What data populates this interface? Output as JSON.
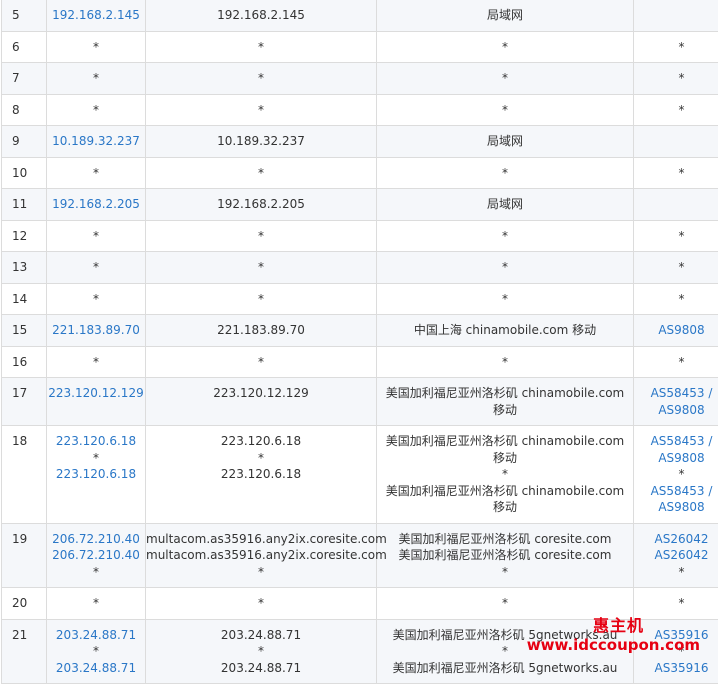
{
  "rows": [
    {
      "hop": "5",
      "ips": [
        "192.168.2.145"
      ],
      "hosts": [
        "192.168.2.145"
      ],
      "locs": [
        "局域网"
      ],
      "as": []
    },
    {
      "hop": "6",
      "ips": [
        "*"
      ],
      "hosts": [
        "*"
      ],
      "locs": [
        "*"
      ],
      "as": [
        "*"
      ]
    },
    {
      "hop": "7",
      "ips": [
        "*"
      ],
      "hosts": [
        "*"
      ],
      "locs": [
        "*"
      ],
      "as": [
        "*"
      ]
    },
    {
      "hop": "8",
      "ips": [
        "*"
      ],
      "hosts": [
        "*"
      ],
      "locs": [
        "*"
      ],
      "as": [
        "*"
      ]
    },
    {
      "hop": "9",
      "ips": [
        "10.189.32.237"
      ],
      "hosts": [
        "10.189.32.237"
      ],
      "locs": [
        "局域网"
      ],
      "as": []
    },
    {
      "hop": "10",
      "ips": [
        "*"
      ],
      "hosts": [
        "*"
      ],
      "locs": [
        "*"
      ],
      "as": [
        "*"
      ]
    },
    {
      "hop": "11",
      "ips": [
        "192.168.2.205"
      ],
      "hosts": [
        "192.168.2.205"
      ],
      "locs": [
        "局域网"
      ],
      "as": []
    },
    {
      "hop": "12",
      "ips": [
        "*"
      ],
      "hosts": [
        "*"
      ],
      "locs": [
        "*"
      ],
      "as": [
        "*"
      ]
    },
    {
      "hop": "13",
      "ips": [
        "*"
      ],
      "hosts": [
        "*"
      ],
      "locs": [
        "*"
      ],
      "as": [
        "*"
      ]
    },
    {
      "hop": "14",
      "ips": [
        "*"
      ],
      "hosts": [
        "*"
      ],
      "locs": [
        "*"
      ],
      "as": [
        "*"
      ]
    },
    {
      "hop": "15",
      "ips": [
        "221.183.89.70"
      ],
      "hosts": [
        "221.183.89.70"
      ],
      "locs": [
        "中国上海 chinamobile.com 移动"
      ],
      "as": [
        "AS9808"
      ]
    },
    {
      "hop": "16",
      "ips": [
        "*"
      ],
      "hosts": [
        "*"
      ],
      "locs": [
        "*"
      ],
      "as": [
        "*"
      ]
    },
    {
      "hop": "17",
      "ips": [
        "223.120.12.129"
      ],
      "hosts": [
        "223.120.12.129"
      ],
      "locs": [
        "美国加利福尼亚州洛杉矶 chinamobile.com",
        "移动"
      ],
      "as": [
        "AS58453 /",
        "AS9808"
      ]
    },
    {
      "hop": "18",
      "ips": [
        "223.120.6.18",
        "*",
        "223.120.6.18"
      ],
      "hosts": [
        "223.120.6.18",
        "*",
        "223.120.6.18"
      ],
      "locs": [
        "美国加利福尼亚州洛杉矶 chinamobile.com",
        "移动",
        "*",
        "美国加利福尼亚州洛杉矶 chinamobile.com",
        "移动"
      ],
      "as": [
        "AS58453 /",
        "AS9808",
        "*",
        "AS58453 /",
        "AS9808"
      ]
    },
    {
      "hop": "19",
      "ips": [
        "206.72.210.40",
        "206.72.210.40",
        "*"
      ],
      "hosts": [
        "multacom.as35916.any2ix.coresite.com",
        "multacom.as35916.any2ix.coresite.com",
        "*"
      ],
      "locs": [
        "美国加利福尼亚州洛杉矶 coresite.com",
        "美国加利福尼亚州洛杉矶 coresite.com",
        "*"
      ],
      "as": [
        "AS26042",
        "AS26042",
        "*"
      ]
    },
    {
      "hop": "20",
      "ips": [
        "*"
      ],
      "hosts": [
        "*"
      ],
      "locs": [
        "*"
      ],
      "as": [
        "*"
      ]
    },
    {
      "hop": "21",
      "ips": [
        "203.24.88.71",
        "*",
        "203.24.88.71"
      ],
      "hosts": [
        "203.24.88.71",
        "*",
        "203.24.88.71"
      ],
      "locs": [
        "美国加利福尼亚州洛杉矶 5gnetworks.au",
        "*",
        "美国加利福尼亚州洛杉矶 5gnetworks.au"
      ],
      "as": [
        "AS35916",
        "*",
        "AS35916"
      ]
    }
  ],
  "watermark": {
    "cn": "惠主机",
    "url": "www.idccoupon.com"
  }
}
